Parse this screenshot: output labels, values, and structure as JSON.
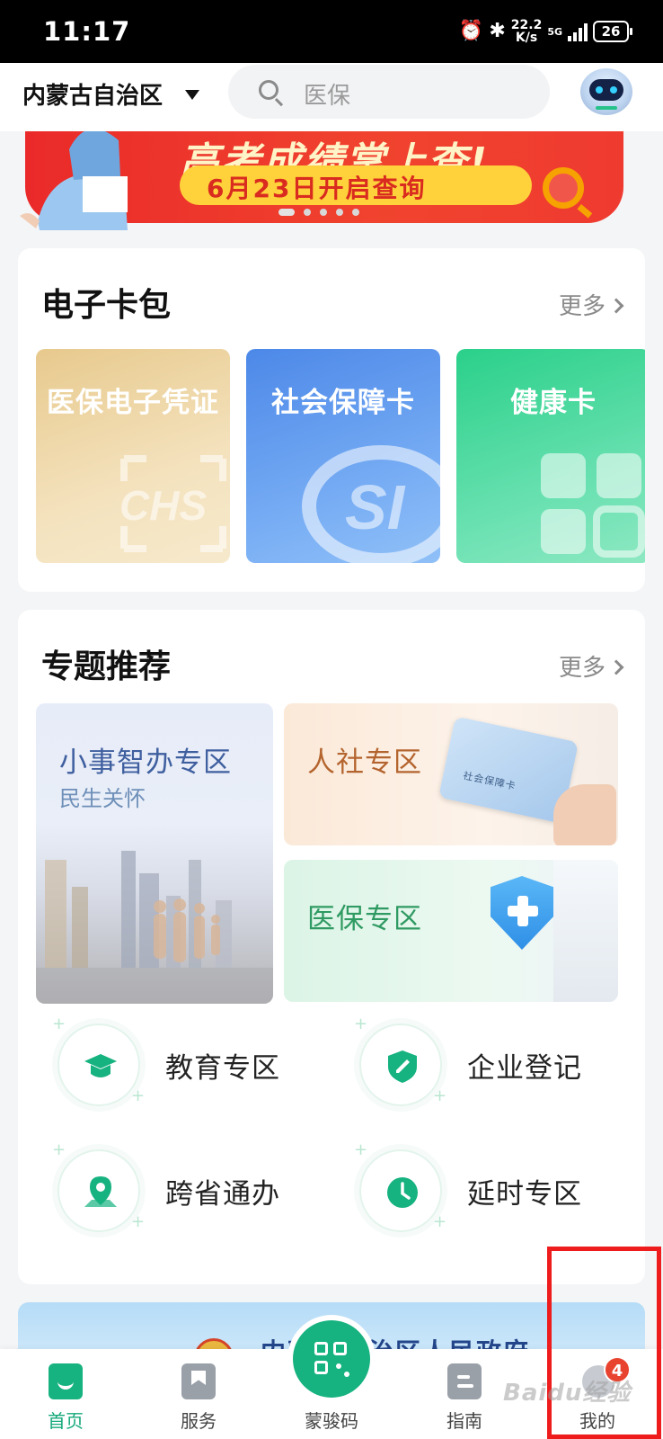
{
  "status_bar": {
    "time": "11:17",
    "net_speed_value": "22.2",
    "net_speed_unit": "K/s",
    "network": "5G",
    "battery": "26"
  },
  "header": {
    "region": "内蒙古自治区",
    "search_placeholder": "医保"
  },
  "banner": {
    "title": "高考成绩掌上查!",
    "subtitle": "6月23日开启查询",
    "page_count": 5,
    "active_page": 0
  },
  "card_wallet": {
    "title": "电子卡包",
    "more": "更多",
    "cards": [
      {
        "label": "医保电子凭证",
        "color": "#e7c98d"
      },
      {
        "label": "社会保障卡",
        "color": "#4c88e8"
      },
      {
        "label": "健康卡",
        "color": "#2ad08a"
      }
    ]
  },
  "topics": {
    "title": "专题推荐",
    "more": "更多",
    "tiles": [
      {
        "title": "小事智办专区",
        "subtitle": "民生关怀"
      },
      {
        "title": "人社专区"
      },
      {
        "title": "医保专区"
      }
    ],
    "quick": [
      {
        "label": "教育专区",
        "icon": "graduation-cap-icon"
      },
      {
        "label": "企业登记",
        "icon": "shield-edit-icon"
      },
      {
        "label": "跨省通办",
        "icon": "map-pin-icon"
      },
      {
        "label": "延时专区",
        "icon": "clock-icon"
      }
    ],
    "social_card_text": "社会保障卡"
  },
  "gov_banner": {
    "text": "内蒙古自治区人民政府"
  },
  "bottom_nav": {
    "items": [
      {
        "label": "首页",
        "active": true
      },
      {
        "label": "服务"
      },
      {
        "label": "蒙骏码"
      },
      {
        "label": "指南"
      },
      {
        "label": "我的",
        "badge": "4"
      }
    ]
  },
  "colors": {
    "accent": "#16b27f",
    "highlight": "#ee1c1c"
  },
  "watermark": "Baidu经验"
}
